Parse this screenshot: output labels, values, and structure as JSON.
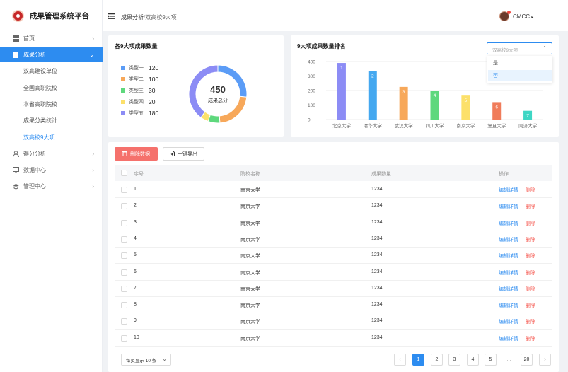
{
  "app": {
    "title": "成果管理系统平台"
  },
  "header": {
    "breadcrumb_parent": "成果分析",
    "breadcrumb_sep": "/",
    "breadcrumb_current": "双高校9大项",
    "user": "CMCC",
    "user_caret": "▸"
  },
  "sidebar": {
    "items": [
      {
        "label": "首页",
        "arrow": "›"
      },
      {
        "label": "成果分析",
        "arrow": "⌄"
      },
      {
        "label": "得分分析",
        "arrow": "›"
      },
      {
        "label": "数据中心",
        "arrow": "›"
      },
      {
        "label": "管理中心",
        "arrow": "›"
      }
    ],
    "submenu": [
      "双高建设单位",
      "全国高职院校",
      "本省高职院校",
      "成果分类统计",
      "双高校9大项"
    ]
  },
  "donut_panel": {
    "title": "各9大项成果数量",
    "total": "450",
    "total_label": "成果总分",
    "legend": [
      {
        "label": "类型一",
        "value": "120",
        "color": "#5b9cf6"
      },
      {
        "label": "类型二",
        "value": "100",
        "color": "#f7a85a"
      },
      {
        "label": "类型三",
        "value": "30",
        "color": "#5ed87d"
      },
      {
        "label": "类型四",
        "value": "20",
        "color": "#fce06a"
      },
      {
        "label": "类型五",
        "value": "180",
        "color": "#8c8cf5"
      }
    ]
  },
  "bar_panel": {
    "title": "9大项成果数量排名",
    "select_placeholder": "双高校9大项",
    "select_arrow": "⌃",
    "options": [
      "是",
      "否"
    ]
  },
  "chart_data": {
    "type": "bar",
    "title": "9大项成果数量排名",
    "categories": [
      "北京大学",
      "清华大学",
      "武汉大学",
      "四川大学",
      "南京大学",
      "复旦大学",
      "同济大学"
    ],
    "values": [
      390,
      335,
      225,
      200,
      165,
      120,
      60
    ],
    "rank_labels": [
      "1",
      "2",
      "3",
      "4",
      "5",
      "6",
      "7"
    ],
    "colors": [
      "#8c8cf5",
      "#44a8f0",
      "#f7a85a",
      "#5ed87d",
      "#fce06a",
      "#f07c5a",
      "#3ed6c4"
    ],
    "ylim": [
      0,
      400
    ],
    "yticks": [
      "0",
      "100",
      "200",
      "300",
      "400"
    ],
    "grid": true
  },
  "toolbar": {
    "delete_label": "删除数据",
    "export_label": "一键导出"
  },
  "table": {
    "headers": [
      "序号",
      "院校名称",
      "成果数量",
      "操作"
    ],
    "rows": [
      {
        "no": "1",
        "name": "南京大学",
        "count": "1234"
      },
      {
        "no": "2",
        "name": "南京大学",
        "count": "1234"
      },
      {
        "no": "3",
        "name": "南京大学",
        "count": "1234"
      },
      {
        "no": "4",
        "name": "南京大学",
        "count": "1234"
      },
      {
        "no": "5",
        "name": "南京大学",
        "count": "1234"
      },
      {
        "no": "6",
        "name": "南京大学",
        "count": "1234"
      },
      {
        "no": "7",
        "name": "南京大学",
        "count": "1234"
      },
      {
        "no": "8",
        "name": "南京大学",
        "count": "1234"
      },
      {
        "no": "9",
        "name": "南京大学",
        "count": "1234"
      },
      {
        "no": "10",
        "name": "南京大学",
        "count": "1234"
      }
    ],
    "edit_label": "编辑详情",
    "delete_label": "删除"
  },
  "pagination": {
    "page_size_label": "每页显示 10 条",
    "pages": [
      "1",
      "2",
      "3",
      "4",
      "5",
      "...",
      "20"
    ],
    "current": "1",
    "prev": "‹",
    "next": "›"
  }
}
